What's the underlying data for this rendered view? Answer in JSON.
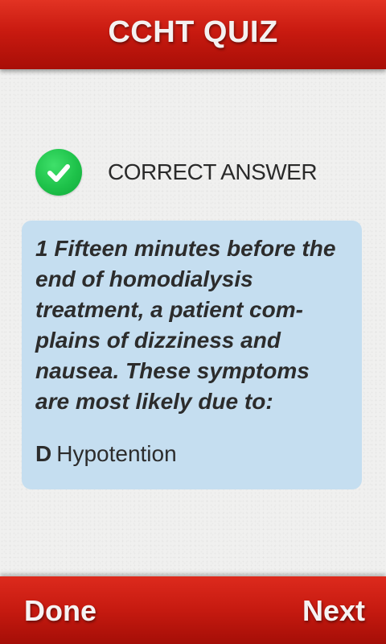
{
  "header": {
    "title": "CCHT QUIZ"
  },
  "status": {
    "text": "CORRECT ANSWER",
    "icon": "check-circle-icon",
    "color": "#1ec24a"
  },
  "question": {
    "text": "1 Fifteen minutes before the end of homodialysis treatment, a patient com-plains of dizziness and nausea. These symptoms are most likely due to:",
    "answer_letter": "D",
    "answer_text": "Hypotention"
  },
  "footer": {
    "done_label": "Done",
    "next_label": "Next"
  },
  "colors": {
    "header": "#c91a10",
    "card": "#c5def0",
    "background": "#f0f0ef"
  }
}
